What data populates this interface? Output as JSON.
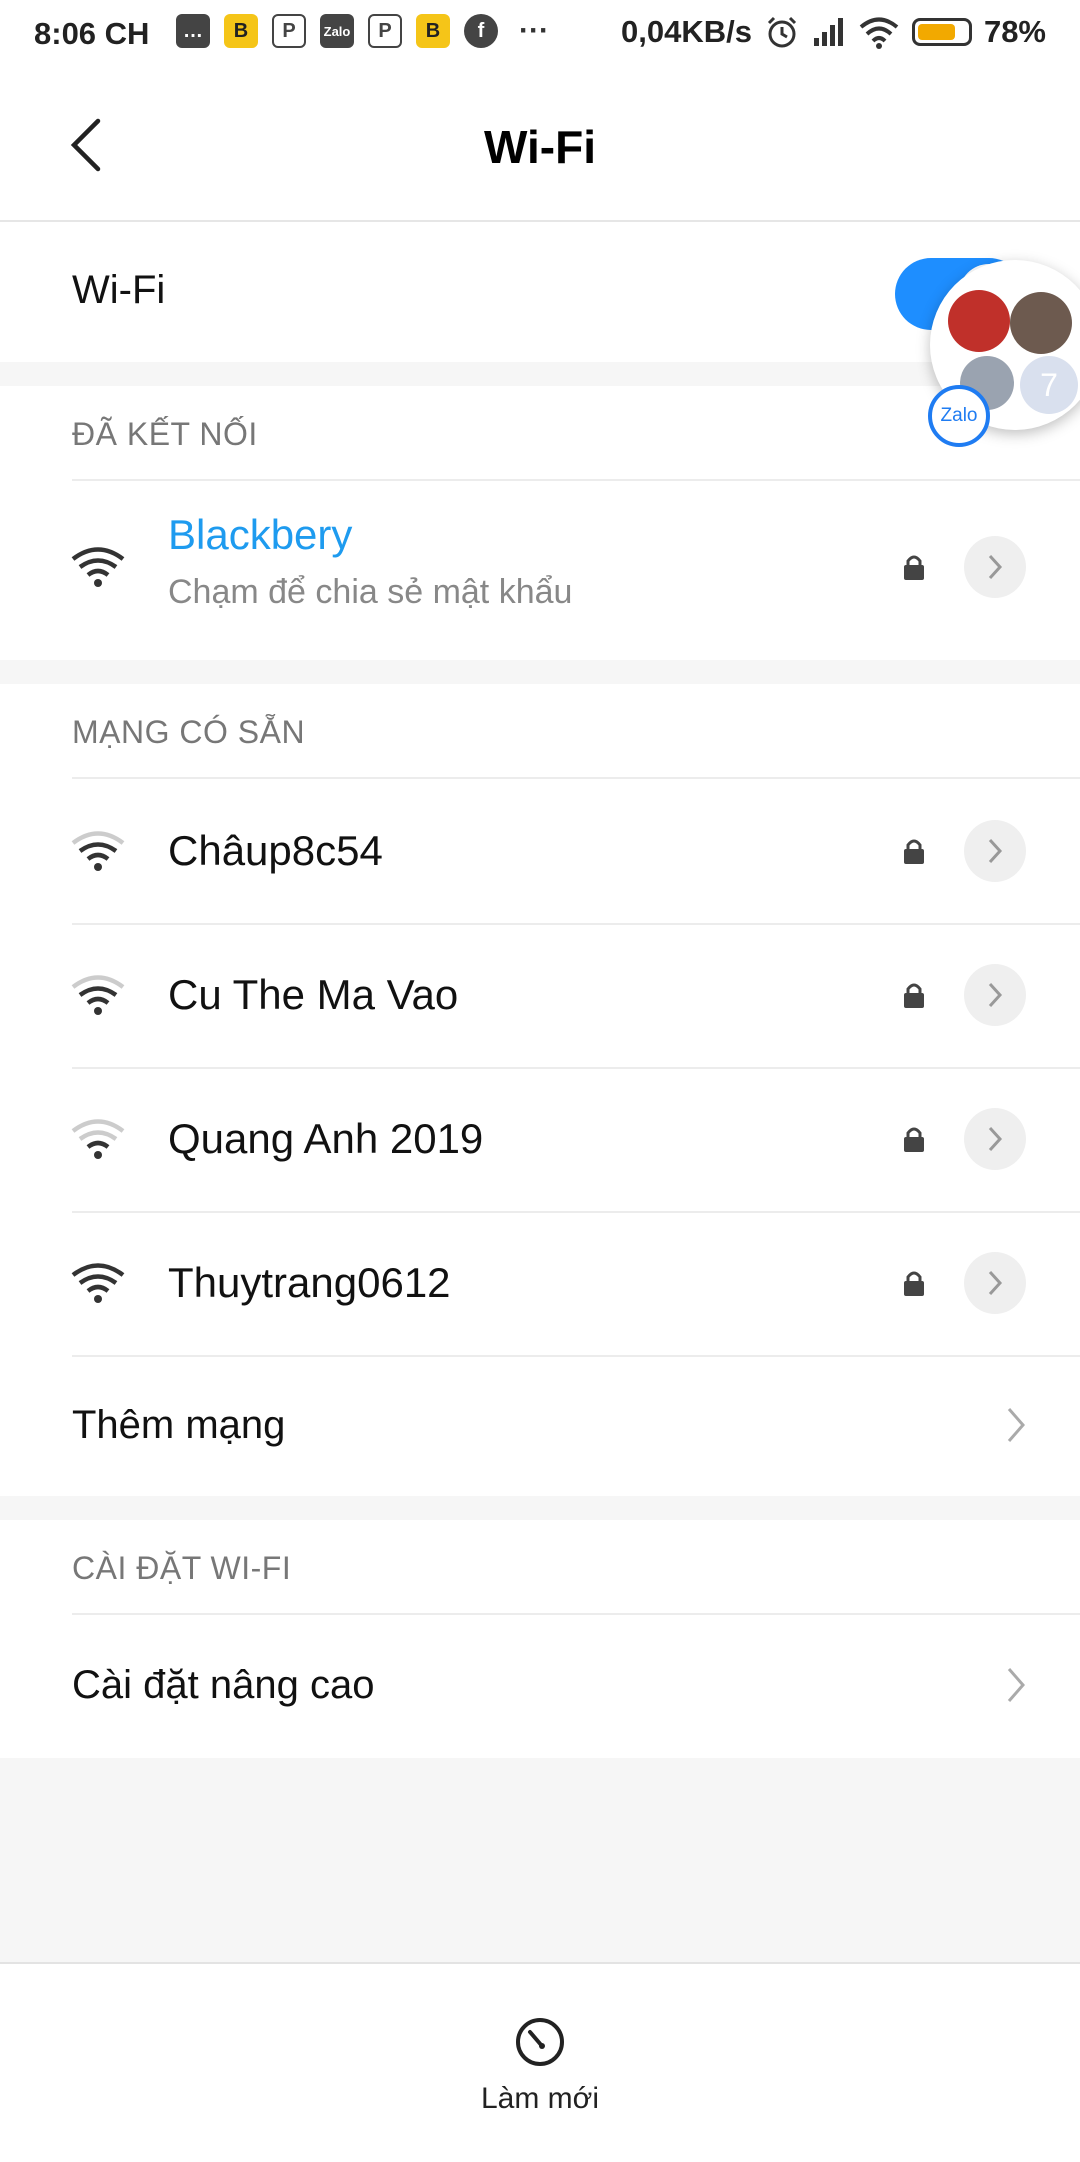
{
  "status_bar": {
    "time": "8:06 CH",
    "network_speed": "0,04KB/s",
    "battery_percent": "78%",
    "battery_level": 0.78,
    "notification_icons": [
      "message-icon",
      "b-app-icon",
      "p-app-icon",
      "zalo-icon",
      "p-app-icon",
      "b-app-icon",
      "facebook-icon",
      "more-icon"
    ],
    "notif_zalo_text": "Zalo",
    "notif_b_text": "B",
    "notif_more_text": "···"
  },
  "app_bar": {
    "title": "Wi-Fi",
    "back_icon": "chevron-left-icon"
  },
  "wifi_toggle": {
    "label": "Wi-Fi",
    "enabled": true,
    "accent_color": "#1e8eff"
  },
  "chat_head": {
    "unread_count": "7",
    "badge_text": "Zalo"
  },
  "connected_section": {
    "header": "ĐÃ KẾT NỐI",
    "network": {
      "name": "Blackbery",
      "subtitle": "Chạm để chia sẻ mật khẩu",
      "name_color": "#1e9bef",
      "secured": true,
      "signal": 3
    }
  },
  "available_section": {
    "header": "MẠNG CÓ SẴN",
    "networks": [
      {
        "name": "Châup8c54",
        "secured": true,
        "signal": 2
      },
      {
        "name": "Cu The Ma Vao",
        "secured": true,
        "signal": 2
      },
      {
        "name": "Quang Anh 2019",
        "secured": true,
        "signal": 1
      },
      {
        "name": "Thuytrang0612",
        "secured": true,
        "signal": 3
      }
    ],
    "add_network_label": "Thêm mạng"
  },
  "settings_section": {
    "header": "CÀI ĐẶT WI-FI",
    "advanced_label": "Cài đặt nâng cao"
  },
  "bottom_bar": {
    "refresh_label": "Làm mới",
    "refresh_icon": "refresh-icon"
  }
}
